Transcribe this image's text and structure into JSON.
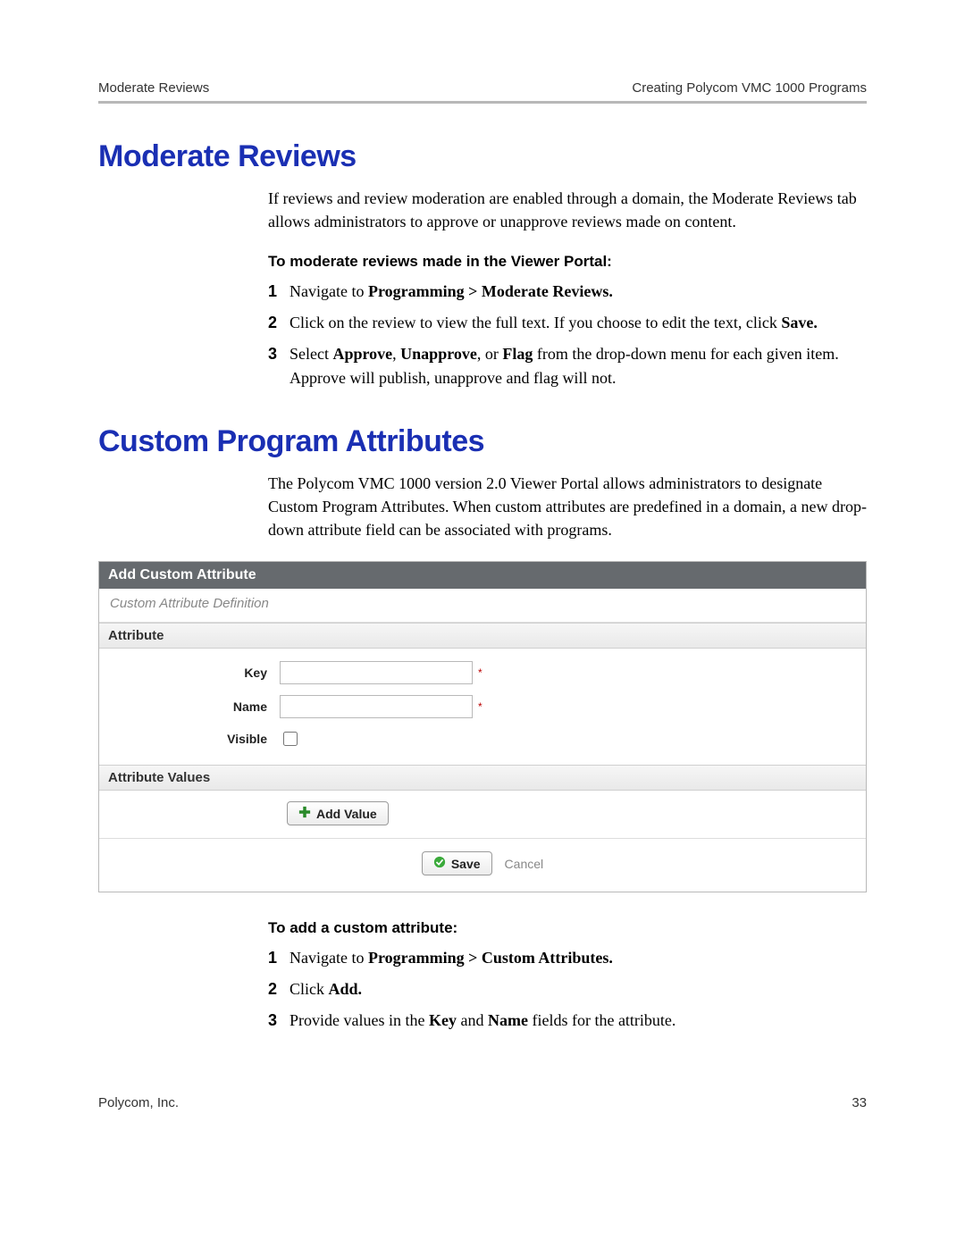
{
  "header": {
    "left": "Moderate Reviews",
    "right": "Creating Polycom VMC 1000 Programs"
  },
  "section1": {
    "title": "Moderate Reviews",
    "intro": "If reviews and review moderation are enabled through a domain, the Moderate Reviews tab allows administrators to approve or unapprove reviews made on content.",
    "subhead": "To moderate reviews made in the Viewer Portal:",
    "steps": [
      {
        "n": "1",
        "pre": "Navigate to ",
        "bold": "Programming > Moderate Reviews.",
        "post": ""
      },
      {
        "n": "2",
        "pre": "Click on the review to view the full text. If you choose to edit the text, click ",
        "bold": "Save.",
        "post": ""
      },
      {
        "n": "3",
        "pre": "Select ",
        "bold": "Approve",
        "mid1": ", ",
        "bold2": "Unapprove",
        "mid2": ", or ",
        "bold3": "Flag",
        "post": " from the drop-down menu for each given item. Approve will publish, unapprove and flag will not."
      }
    ]
  },
  "section2": {
    "title": "Custom Program Attributes",
    "intro": "The Polycom VMC 1000 version 2.0 Viewer Portal allows administrators to designate Custom Program Attributes. When custom attributes are predefined in a domain, a new drop-down attribute field can be associated with programs.",
    "panel": {
      "title": "Add Custom Attribute",
      "defn": "Custom Attribute Definition",
      "attr_head": "Attribute",
      "key_label": "Key",
      "name_label": "Name",
      "visible_label": "Visible",
      "values_head": "Attribute Values",
      "add_value": "Add Value",
      "save": "Save",
      "cancel": "Cancel",
      "asterisk": "*"
    },
    "subhead": "To add a custom attribute:",
    "steps": [
      {
        "n": "1",
        "pre": "Navigate to ",
        "bold": "Programming > Custom Attributes.",
        "post": ""
      },
      {
        "n": "2",
        "pre": "Click ",
        "bold": "Add.",
        "post": ""
      },
      {
        "n": "3",
        "pre": "Provide values in the ",
        "bold": "Key",
        "mid1": " and ",
        "bold2": "Name",
        "post": " fields for the attribute."
      }
    ]
  },
  "footer": {
    "left": "Polycom, Inc.",
    "right": "33"
  }
}
